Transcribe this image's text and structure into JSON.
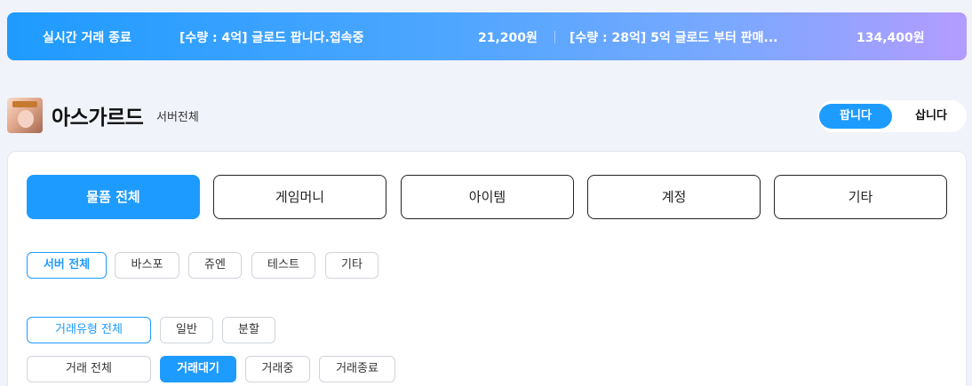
{
  "ticker": {
    "label": "실시간 거래 종료",
    "items": [
      {
        "title": "[수량 : 4억] 글로드 팝니다.접속중",
        "price": "21,200원"
      },
      {
        "title": "[수량 : 28억] 5억 글로드 부터 판매...",
        "price": "134,400원"
      }
    ]
  },
  "header": {
    "game_title": "아스가르드",
    "server_label": "서버전체",
    "toggle": {
      "sell": "팝니다",
      "buy": "삽니다",
      "active": "sell"
    }
  },
  "categories": [
    {
      "label": "물품 전체",
      "active": true
    },
    {
      "label": "게임머니",
      "active": false
    },
    {
      "label": "아이템",
      "active": false
    },
    {
      "label": "계정",
      "active": false
    },
    {
      "label": "기타",
      "active": false
    }
  ],
  "servers": [
    {
      "label": "서버 전체",
      "active": true
    },
    {
      "label": "바스포",
      "active": false
    },
    {
      "label": "쥬엔",
      "active": false
    },
    {
      "label": "테스트",
      "active": false
    },
    {
      "label": "기타",
      "active": false
    }
  ],
  "trade_types": [
    {
      "label": "거래유형 전체",
      "active": true
    },
    {
      "label": "일반",
      "active": false
    },
    {
      "label": "분할",
      "active": false
    }
  ],
  "trade_status": [
    {
      "label": "거래 전체",
      "active": false
    },
    {
      "label": "거래대기",
      "active": true
    },
    {
      "label": "거래중",
      "active": false
    },
    {
      "label": "거래종료",
      "active": false
    }
  ],
  "colors": {
    "accent": "#1e9bff",
    "background": "#f1f3fb"
  }
}
